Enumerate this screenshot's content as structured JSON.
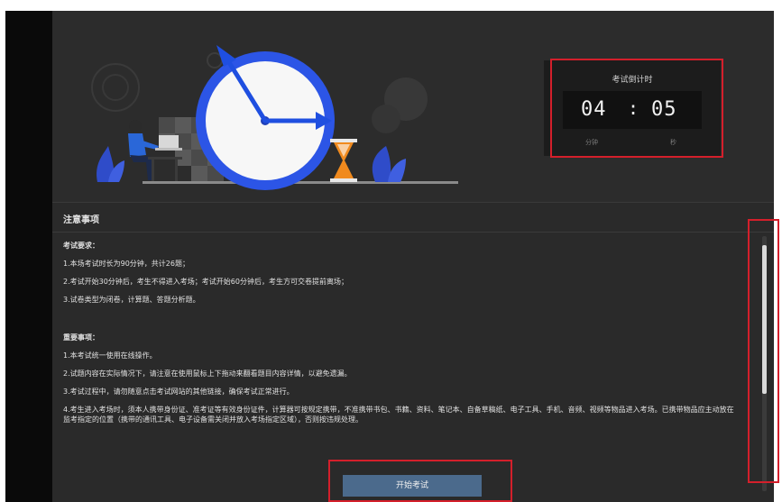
{
  "countdown": {
    "title": "考试倒计时",
    "minutes": "04",
    "separator": ":",
    "seconds": "05",
    "minutes_unit": "分钟",
    "seconds_unit": "秒"
  },
  "notice": {
    "header": "注意事项",
    "exam_rules_title": "考试要求：",
    "exam_rules": [
      "1.本场考试时长为90分钟，共计26题；",
      "2.考试开始30分钟后，考生不得进入考场；考试开始60分钟后，考生方可交卷提前离场；",
      "3.试卷类型为闭卷，计算题、答题分析题。"
    ],
    "important_title": "重要事项：",
    "important_rules": [
      "1.本考试统一使用在线操作。",
      "2.试题内容在实际情况下，请注意在使用鼠标上下拖动来翻看题目内容详情，以避免遗漏。",
      "3.考试过程中，请勿随意点击考试网站的其他链接，确保考试正常进行。",
      "4.考生进入考场时，须本人携带身份证、准考证等有效身份证件，计算器可按规定携带，不准携带书包、书籍、资料、笔记本、自备草稿纸、电子工具、手机、音频、视频等物品进入考场。已携带物品应主动放在监考指定的位置（携带的通讯工具、电子设备需关闭并放入考场指定区域），否则按违规处理。"
    ]
  },
  "start_button": {
    "label": "开始考试"
  },
  "colors": {
    "panel_bg": "#2a2a2a",
    "highlight": "#d41f2b",
    "button_bg": "#4b6a8c",
    "clock_blue": "#1f5ee0",
    "hourglass_orange": "#f08a1e"
  },
  "icons": {
    "illustration": "clock-hourglass-illustration",
    "person": "person-at-laptop-icon"
  }
}
